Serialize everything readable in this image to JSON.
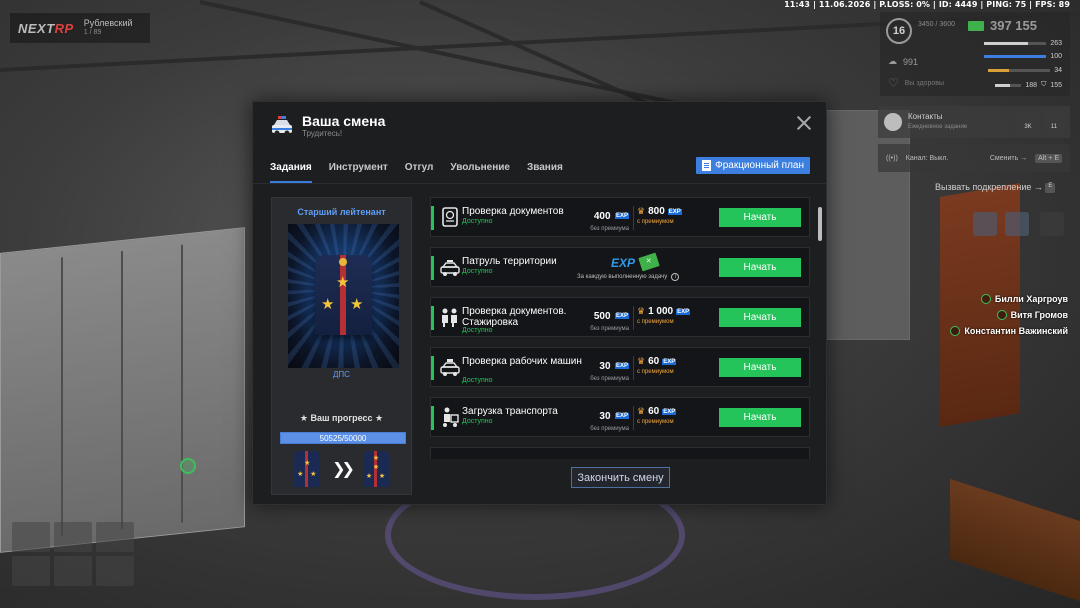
{
  "hud": {
    "topline": "11:43 | 11.06.2026 | P.LOSS: 0% | ID: 4449 | PING: 75 | FPS: 89",
    "logo": {
      "left": "NEXT",
      "right": "RP"
    },
    "region": {
      "name": "Рублевский",
      "sub": "1 / 89"
    },
    "level": "16",
    "exp_mini": "3450 / 3600",
    "money": "397 155",
    "coins": "991",
    "stats": [
      {
        "value": "263",
        "color": "#cfcfcf",
        "fill": 0.7
      },
      {
        "value": "100",
        "color": "#3d7fe0",
        "fill": 1.0
      },
      {
        "value": "34",
        "color": "#d9a03a",
        "fill": 0.34
      },
      {
        "value": "155",
        "color": "#cfcfcf",
        "fill": 0.55
      }
    ],
    "stat_bottom": "188",
    "health_label": "Вы здоровы",
    "contacts": {
      "title": "Контакты",
      "sub": "Ежедневное задание",
      "tile1": "3K",
      "tile2": "11"
    },
    "radio": {
      "label": "Канал: Выкл.",
      "switch": "Сменить →",
      "keys": "Alt + E"
    },
    "backup": "Вызвать подкрепление →",
    "players": [
      "Билли Харгроув",
      "Витя Громов",
      "Константин Важинский"
    ]
  },
  "window": {
    "title": "Ваша смена",
    "subtitle": "Трудитесь!",
    "tabs": [
      "Задания",
      "Инструмент",
      "Отгул",
      "Увольнение",
      "Звания"
    ],
    "faction_button": "Фракционный план",
    "finish_button": "Закончить смену"
  },
  "rank": {
    "name": "Старший лейтенант",
    "unit": "ДПС",
    "progress_title": "★ Ваш прогресс ★",
    "progress_text": "50525/50000",
    "progress_fraction": 1.0
  },
  "labels": {
    "without_premium": "без премиума",
    "with_premium": "с премиумом",
    "exp": "EXP",
    "start": "Начать",
    "available": "Доступно",
    "each_task": "За каждую выполненную задачу"
  },
  "tasks": [
    {
      "name": "Проверка документов",
      "icon": "passport-icon",
      "exp": "400",
      "premium_exp": "800"
    },
    {
      "name": "Патруль территории",
      "icon": "police-car-icon",
      "reward_type": "exp-and-cash"
    },
    {
      "name": "Проверка документов. Стажировка",
      "icon": "officers-icon",
      "exp": "500",
      "premium_exp": "1 000"
    },
    {
      "name": "Проверка рабочих машин",
      "icon": "taxi-icon",
      "exp": "30",
      "premium_exp": "60"
    },
    {
      "name": "Загрузка транспорта",
      "icon": "loader-icon",
      "exp": "30",
      "premium_exp": "60"
    }
  ]
}
